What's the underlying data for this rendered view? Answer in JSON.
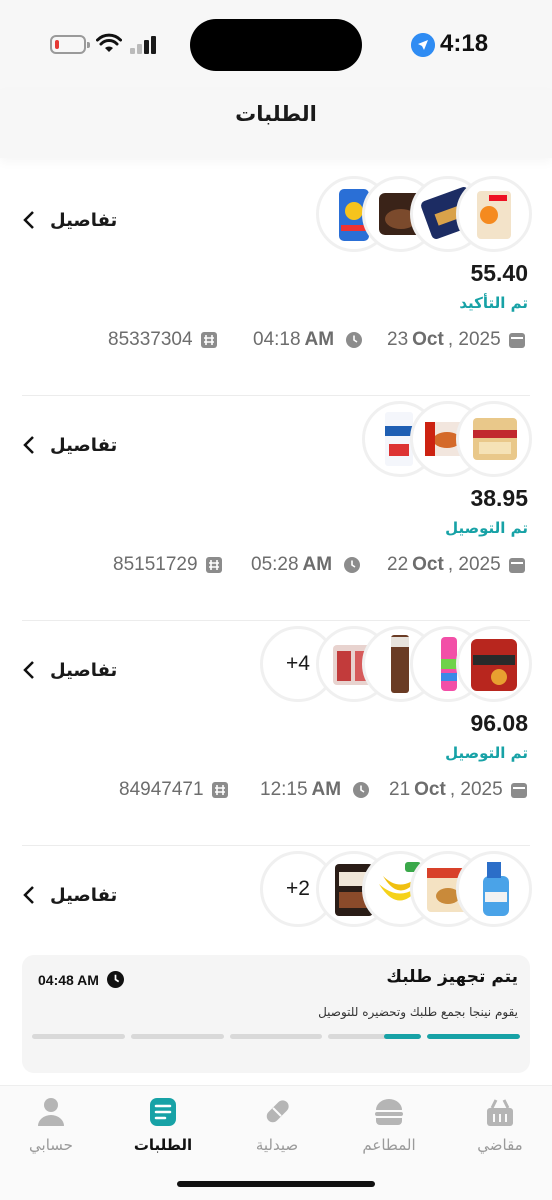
{
  "status_bar": {
    "time": "4:18",
    "battery_level": 0.15,
    "icons": [
      "battery-icon",
      "wifi-icon",
      "signal-icon",
      "location-arrow-icon"
    ]
  },
  "header": {
    "title": "الطلبات"
  },
  "orders": [
    {
      "details_label": "تفاصيل",
      "price": "55.40",
      "status": "تم التأكيد",
      "date_day": "23",
      "date_month": "Oct",
      "date_year": ", 2025",
      "time": "04:18",
      "ampm": "AM",
      "order_number": "85337304",
      "more_count": "",
      "colors": {
        "status": "#17a2a6"
      }
    },
    {
      "details_label": "تفاصيل",
      "price": "38.95",
      "status": "تم التوصيل",
      "date_day": "22",
      "date_month": "Oct",
      "date_year": ", 2025",
      "time": "05:28",
      "ampm": "AM",
      "order_number": "85151729",
      "more_count": ""
    },
    {
      "details_label": "تفاصيل",
      "price": "96.08",
      "status": "تم التوصيل",
      "date_day": "21",
      "date_month": "Oct",
      "date_year": ", 2025",
      "time": "12:15",
      "ampm": "AM",
      "order_number": "84947471",
      "more_count": "+4"
    },
    {
      "details_label": "تفاصيل",
      "more_count": "+2"
    }
  ],
  "tracking": {
    "title": "يتم تجهيز طلبك",
    "time": "04:48 AM",
    "description": "يقوم نينجا بجمع طلبك وتحضيره للتوصيل",
    "progress_steps": [
      1.0,
      0.4,
      0,
      0,
      0
    ],
    "accent": "#17a2a6"
  },
  "nav": {
    "items": [
      {
        "label": "مقاضي",
        "icon": "basket-icon",
        "active": false
      },
      {
        "label": "المطاعم",
        "icon": "burger-icon",
        "active": false
      },
      {
        "label": "صيدلية",
        "icon": "pill-icon",
        "active": false
      },
      {
        "label": "الطلبات",
        "icon": "orders-list-icon",
        "active": true
      },
      {
        "label": "حسابي",
        "icon": "user-icon",
        "active": false
      }
    ]
  }
}
